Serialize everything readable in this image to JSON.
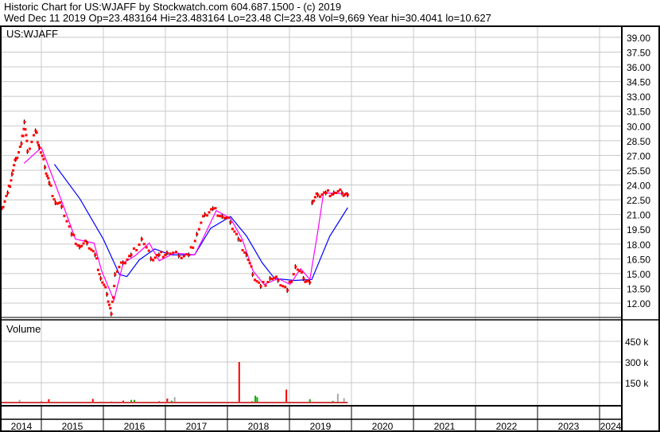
{
  "header": {
    "line1": "Historic Chart for US:WJAFF by Stockwatch.com 604.687.1500 - (c) 2019",
    "line2": "Wed Dec 11 2019   Op=23.483164   Hi=23.483164   Lo=23.48   Cl=23.48   Vol=9,669   Year hi=30.4041   lo=10.627"
  },
  "chart_data": [
    {
      "type": "line",
      "title": "US:WJAFF",
      "x_unit": "year",
      "xlim": [
        2014.36,
        2024.36
      ],
      "ylim": [
        10.5,
        40.0
      ],
      "y_ticks": [
        "39.00",
        "37.50",
        "36.00",
        "34.50",
        "33.00",
        "31.50",
        "30.00",
        "28.50",
        "27.00",
        "25.50",
        "24.00",
        "22.50",
        "21.00",
        "19.50",
        "18.00",
        "16.50",
        "15.00",
        "13.50",
        "12.00"
      ],
      "x_ticks": [
        "2014",
        "2015",
        "2016",
        "2017",
        "2018",
        "2019",
        "2020",
        "2021",
        "2022",
        "2023",
        "2024"
      ],
      "grid": true,
      "colors": {
        "price": "#ff0000",
        "ma_short": "#ff00ff",
        "ma_long": "#0000ff"
      },
      "price": [
        [
          2014.36,
          21.6
        ],
        [
          2014.46,
          23.2
        ],
        [
          2014.53,
          25.1
        ],
        [
          2014.59,
          26.6
        ],
        [
          2014.68,
          28.2
        ],
        [
          2014.73,
          30.4
        ],
        [
          2014.78,
          27.4
        ],
        [
          2014.91,
          29.5
        ],
        [
          2014.97,
          27.8
        ],
        [
          2015.06,
          25.8
        ],
        [
          2015.13,
          24.2
        ],
        [
          2015.23,
          22.2
        ],
        [
          2015.33,
          21.8
        ],
        [
          2015.49,
          19.0
        ],
        [
          2015.62,
          17.7
        ],
        [
          2015.74,
          18.1
        ],
        [
          2015.87,
          16.9
        ],
        [
          2015.96,
          14.5
        ],
        [
          2016.06,
          12.9
        ],
        [
          2016.13,
          10.9
        ],
        [
          2016.19,
          14.9
        ],
        [
          2016.32,
          16.1
        ],
        [
          2016.45,
          16.9
        ],
        [
          2016.62,
          18.5
        ],
        [
          2016.77,
          16.5
        ],
        [
          2016.9,
          16.9
        ],
        [
          2017.03,
          17.1
        ],
        [
          2017.22,
          16.8
        ],
        [
          2017.38,
          16.9
        ],
        [
          2017.51,
          19.0
        ],
        [
          2017.64,
          21.0
        ],
        [
          2017.77,
          21.6
        ],
        [
          2017.92,
          20.8
        ],
        [
          2018.05,
          20.2
        ],
        [
          2018.18,
          18.5
        ],
        [
          2018.31,
          16.9
        ],
        [
          2018.41,
          14.9
        ],
        [
          2018.54,
          13.7
        ],
        [
          2018.69,
          14.5
        ],
        [
          2018.82,
          14.3
        ],
        [
          2018.97,
          13.3
        ],
        [
          2019.1,
          15.7
        ],
        [
          2019.23,
          14.5
        ],
        [
          2019.33,
          14.1
        ],
        [
          2019.37,
          22.2
        ],
        [
          2019.46,
          23.0
        ],
        [
          2019.59,
          23.2
        ],
        [
          2019.72,
          23.2
        ],
        [
          2019.85,
          23.2
        ],
        [
          2019.94,
          23.0
        ]
      ],
      "ma_short": [
        [
          2014.72,
          26.2
        ],
        [
          2015.0,
          27.8
        ],
        [
          2015.17,
          25.0
        ],
        [
          2015.36,
          21.8
        ],
        [
          2015.55,
          18.5
        ],
        [
          2015.85,
          18.1
        ],
        [
          2015.97,
          15.3
        ],
        [
          2016.17,
          12.3
        ],
        [
          2016.32,
          16.1
        ],
        [
          2016.51,
          16.8
        ],
        [
          2016.74,
          18.1
        ],
        [
          2016.9,
          16.3
        ],
        [
          2017.15,
          17.1
        ],
        [
          2017.47,
          16.9
        ],
        [
          2017.6,
          18.5
        ],
        [
          2017.82,
          21.4
        ],
        [
          2018.05,
          20.6
        ],
        [
          2018.24,
          18.5
        ],
        [
          2018.41,
          15.3
        ],
        [
          2018.59,
          13.9
        ],
        [
          2018.82,
          14.5
        ],
        [
          2019.01,
          13.9
        ],
        [
          2019.18,
          15.5
        ],
        [
          2019.33,
          14.4
        ],
        [
          2019.46,
          19.4
        ],
        [
          2019.55,
          23.2
        ],
        [
          2019.94,
          23.1
        ]
      ],
      "ma_long": [
        [
          2015.21,
          26.1
        ],
        [
          2015.62,
          22.6
        ],
        [
          2016.0,
          18.5
        ],
        [
          2016.26,
          14.9
        ],
        [
          2016.38,
          14.7
        ],
        [
          2016.58,
          16.4
        ],
        [
          2016.83,
          17.5
        ],
        [
          2017.09,
          16.9
        ],
        [
          2017.47,
          16.9
        ],
        [
          2017.73,
          19.6
        ],
        [
          2018.05,
          20.8
        ],
        [
          2018.31,
          18.8
        ],
        [
          2018.56,
          16.1
        ],
        [
          2018.76,
          14.5
        ],
        [
          2019.08,
          14.3
        ],
        [
          2019.36,
          14.4
        ],
        [
          2019.65,
          18.8
        ],
        [
          2019.94,
          21.7
        ]
      ]
    },
    {
      "type": "bar",
      "title": "Volume",
      "x_unit": "year",
      "ylim": [
        0,
        540000
      ],
      "y_ticks": [
        "450 k",
        "300 k",
        "150 k"
      ],
      "grid": true,
      "colors": {
        "up": "#00b000",
        "down": "#ff0000",
        "unchanged": "#aaaaaa"
      },
      "bars": [
        [
          2014.65,
          25000,
          "unchanged"
        ],
        [
          2014.5,
          8000,
          "up"
        ],
        [
          2014.8,
          6000,
          "down"
        ],
        [
          2015.0,
          18000,
          "unchanged"
        ],
        [
          2015.12,
          30000,
          "down"
        ],
        [
          2015.4,
          8000,
          "down"
        ],
        [
          2015.7,
          10000,
          "unchanged"
        ],
        [
          2015.83,
          32000,
          "down"
        ],
        [
          2015.95,
          12000,
          "up"
        ],
        [
          2016.13,
          15000,
          "unchanged"
        ],
        [
          2016.32,
          20000,
          "down"
        ],
        [
          2016.45,
          25000,
          "up"
        ],
        [
          2016.5,
          25000,
          "up"
        ],
        [
          2016.7,
          12000,
          "unchanged"
        ],
        [
          2016.9,
          15000,
          "down"
        ],
        [
          2017.03,
          35000,
          "down"
        ],
        [
          2017.1,
          20000,
          "up"
        ],
        [
          2017.15,
          45000,
          "unchanged"
        ],
        [
          2017.3,
          8000,
          "down"
        ],
        [
          2017.5,
          10000,
          "up"
        ],
        [
          2017.8,
          12000,
          "unchanged"
        ],
        [
          2018.19,
          300000,
          "down"
        ],
        [
          2018.4,
          15000,
          "up"
        ],
        [
          2018.45,
          55000,
          "up"
        ],
        [
          2018.48,
          45000,
          "up"
        ],
        [
          2018.6,
          10000,
          "unchanged"
        ],
        [
          2018.95,
          100000,
          "down"
        ],
        [
          2019.1,
          10000,
          "unchanged"
        ],
        [
          2019.33,
          30000,
          "up"
        ],
        [
          2019.45,
          12000,
          "down"
        ],
        [
          2019.6,
          10000,
          "unchanged"
        ],
        [
          2019.7,
          18000,
          "up"
        ],
        [
          2019.78,
          70000,
          "unchanged"
        ],
        [
          2019.88,
          38000,
          "unchanged"
        ]
      ]
    }
  ]
}
